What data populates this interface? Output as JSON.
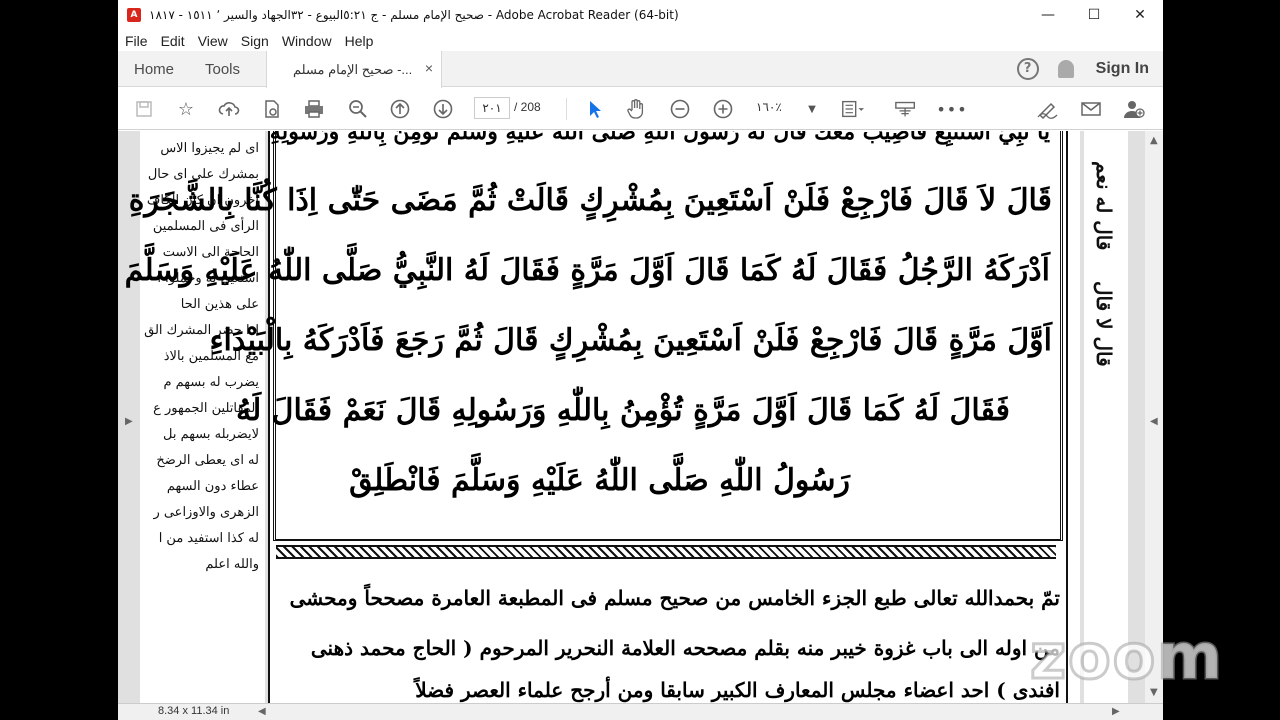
{
  "window": {
    "title": "صحيح الإمام مسلم - ج ٥:٢١البيوع - ٣٢الجهاد والسير ٬ ١٥١١ - ١٨١٧ - Adobe Acrobat Reader (64-bit)",
    "minimize": "—",
    "maximize": "☐",
    "close": "✕"
  },
  "menu": [
    "File",
    "Edit",
    "View",
    "Sign",
    "Window",
    "Help"
  ],
  "tabs": {
    "home": "Home",
    "tools": "Tools",
    "doc": "صحيح الإمام مسلم -...",
    "doc_close": "×",
    "help": "?",
    "signin": "Sign In"
  },
  "toolbar": {
    "page_current": "٢٠١",
    "page_total": "/  208",
    "zoom": "١٦٠٪",
    "icons": [
      "save-icon",
      "star-icon",
      "upload-icon",
      "document-search-icon",
      "print-icon",
      "search-icon",
      "page-up-icon",
      "page-down-icon",
      "cursor-icon",
      "hand-icon",
      "zoom-out-icon",
      "zoom-in-icon",
      "fit-page-icon",
      "scan-icon",
      "more-icon",
      "sign-icon",
      "mail-icon",
      "add-user-icon"
    ]
  },
  "left_page": {
    "lines": [
      "اى لم يجيزوا الاس",
      "بمشرك على اى حال",
      "آخرون ان كان الكاف",
      "الرأى فى المسلمين",
      "الحاجة الى الاست",
      "استعين به وحملوا ا",
      "على هذين الحا",
      "اذا حضر المشرك الق",
      "مع المسلمين بالاذ",
      "يضرب له بسهم م",
      "المقاتلين الجمهور ع",
      "لايضربله بسهم بل",
      "له اى يعطى الرضخ",
      "عطاء دون السهم",
      "الزهرى والاوزاعى ر",
      "له كذا استفيد من ا",
      "والله اعلم"
    ]
  },
  "main_page": {
    "line0": "يا نَبِيِّ اَسْتَتْبِعُ فَأُصِيبَ مَعَكَ قَالَ لَهُ رَسُولُ اللّٰهِ صَلَّى اللّٰهُ عَلَيْهِ وَسَلَّمَ تُؤْمِنُ بِاللّٰهِ وَرَسُولِهِ",
    "line1": "قَالَ لاَ قَالَ فَارْجِعْ فَلَنْ اَسْتَعِينَ بِمُشْرِكٍ قَالَتْ ثُمَّ مَضَى حَتّٰى اِذَا كُنَّا بِالشَّجَرَةِ",
    "line2": "اَدْرَكَهُ الرَّجُلُ فَقَالَ لَهُ كَمَا قَالَ اَوَّلَ مَرَّةٍ فَقَالَ لَهُ النَّبِيُّ صَلَّى اللّٰهُ عَلَيْهِ وَسَلَّمَ كَمَا قَالَ",
    "line3": "اَوَّلَ مَرَّةٍ قَالَ فَارْجِعْ فَلَنْ اَسْتَعِينَ بِمُشْرِكٍ قَالَ ثُمَّ رَجَعَ فَاَدْرَكَهُ بِالْبَيْدَاءِ",
    "line4": "فَقَالَ لَهُ كَمَا قَالَ اَوَّلَ مَرَّةٍ تُؤْمِنُ بِاللّٰهِ وَرَسُولِهِ قَالَ نَعَمْ فَقَالَ لَهُ",
    "line5": "رَسُولُ اللّٰهِ صَلَّى اللّٰهُ عَلَيْهِ وَسَلَّمَ فَانْطَلِقْ",
    "foot1": "تمّ بحمدالله تعالى طبع الجزء الخامس من صحيح مسلم فى المطبعة العامرة مصححاً ومحشى",
    "foot2": "من اوله الى باب غزوة خيبر منه بقلم مصححه العلامة النحرير المرحوم ( الحاج محمد ذهنى",
    "foot3": "افندى ) احد اعضاء مجلس المعارف الكبير سابقا ومن أرجح علماء العصر فضلاً"
  },
  "right_margin": {
    "text1": "قال له نعم",
    "text2": "قال لا قال"
  },
  "statusbar": {
    "page_size": "8.34 x 11.34 in"
  },
  "watermark": "zoom"
}
